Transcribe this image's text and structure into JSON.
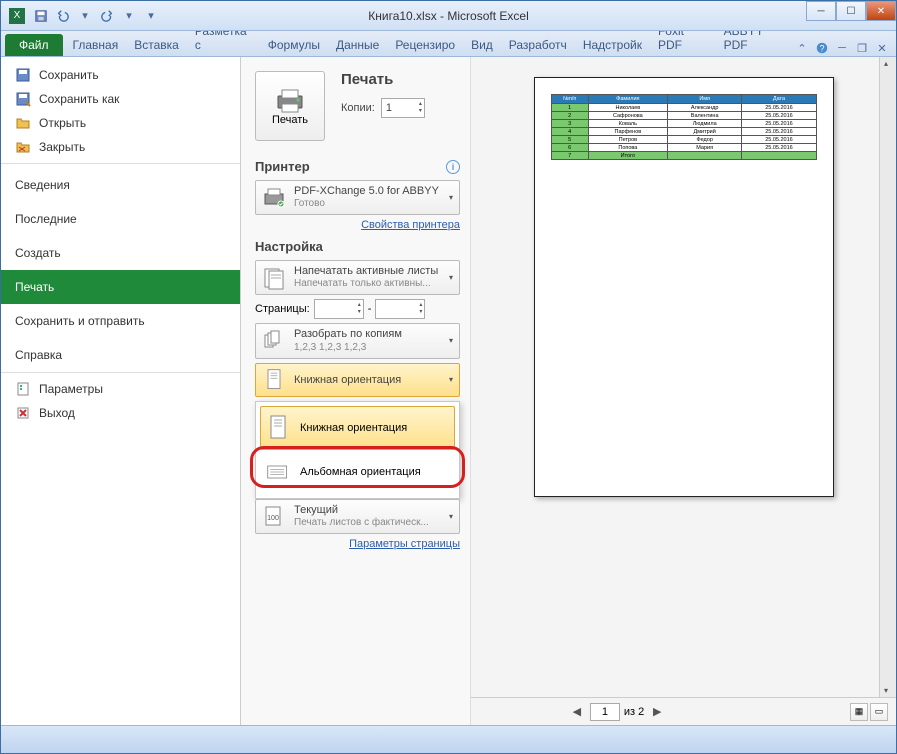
{
  "title": "Книга10.xlsx - Microsoft Excel",
  "ribbon": {
    "file": "Файл",
    "tabs": [
      "Главная",
      "Вставка",
      "Разметка с",
      "Формулы",
      "Данные",
      "Рецензиро",
      "Вид",
      "Разработч",
      "Надстройк",
      "Foxit PDF",
      "ABBYY PDF"
    ]
  },
  "sidebar": {
    "save": "Сохранить",
    "saveas": "Сохранить как",
    "open": "Открыть",
    "close": "Закрыть",
    "info": "Сведения",
    "recent": "Последние",
    "new": "Создать",
    "print": "Печать",
    "send": "Сохранить и отправить",
    "help": "Справка",
    "options": "Параметры",
    "exit": "Выход"
  },
  "print": {
    "title": "Печать",
    "button": "Печать",
    "copies_label": "Копии:",
    "copies_value": "1",
    "printer_h": "Принтер",
    "printer_name": "PDF-XChange 5.0 for ABBYY",
    "printer_status": "Готово",
    "printer_props": "Свойства принтера",
    "settings_h": "Настройка",
    "active_sheets": "Напечатать активные листы",
    "active_sheets_sub": "Напечатать только активны...",
    "pages_label": "Страницы:",
    "pages_sep": "-",
    "collate": "Разобрать по копиям",
    "collate_sub": "1,2,3   1,2,3   1,2,3",
    "orient_current": "Книжная ориентация",
    "orient_portrait": "Книжная ориентация",
    "orient_landscape": "Альбомная ориентация",
    "scaling": "Текущий",
    "scaling_sub": "Печать листов с фактическ...",
    "page_setup": "Параметры страницы"
  },
  "preview": {
    "headers": [
      "№п/п",
      "Фамилия",
      "Имя",
      "Дата"
    ],
    "rows": [
      [
        "1",
        "Николаев",
        "Александр",
        "25.05.2016"
      ],
      [
        "2",
        "Сафронова",
        "Валентина",
        "25.05.2016"
      ],
      [
        "3",
        "Коваль",
        "Людмила",
        "25.05.2016"
      ],
      [
        "4",
        "Парфенов",
        "Дмитрий",
        "25.05.2016"
      ],
      [
        "5",
        "Петров",
        "Федор",
        "25.05.2016"
      ],
      [
        "6",
        "Попова",
        "Мария",
        "25.05.2016"
      ],
      [
        "7",
        "Итого",
        "",
        ""
      ]
    ],
    "page_current": "1",
    "page_total": "из 2"
  }
}
